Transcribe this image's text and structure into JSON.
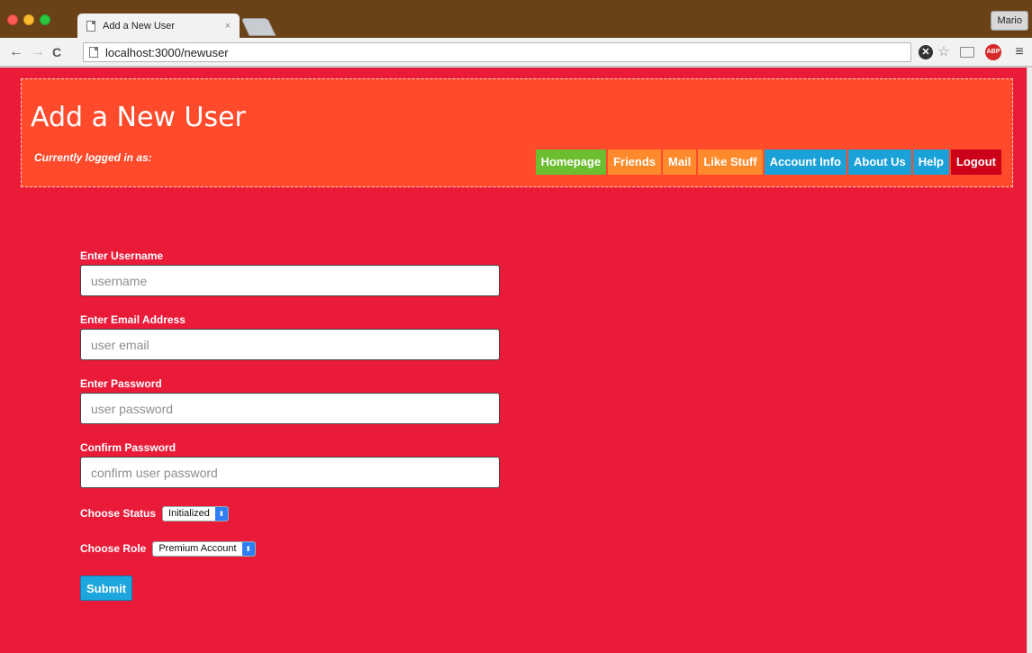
{
  "browser": {
    "tab_title": "Add a New User",
    "tab_close": "×",
    "user_profile": "Mario",
    "url": "localhost:3000/newuser",
    "nav": {
      "back": "←",
      "forward": "→",
      "reload": "C"
    },
    "toolbar_icons": [
      "block-icon",
      "star-icon",
      "cast-icon",
      "adblock-icon",
      "menu-icon"
    ]
  },
  "header": {
    "title": "Add a New User",
    "logged_in_label": "Currently logged in as:",
    "nav_items": [
      {
        "label": "Homepage",
        "color": "#6cbd2f"
      },
      {
        "label": "Friends",
        "color": "#ff8a2b"
      },
      {
        "label": "Mail",
        "color": "#ff8a2b"
      },
      {
        "label": "Like Stuff",
        "color": "#ff8a2b"
      },
      {
        "label": "Account Info",
        "color": "#1aa1d8"
      },
      {
        "label": "About Us",
        "color": "#1aa1d8"
      },
      {
        "label": "Help",
        "color": "#1aa1d8"
      },
      {
        "label": "Logout",
        "color": "#cc0018"
      }
    ]
  },
  "form": {
    "username": {
      "label": "Enter Username",
      "placeholder": "username",
      "value": ""
    },
    "email": {
      "label": "Enter Email Address",
      "placeholder": "user email",
      "value": ""
    },
    "password": {
      "label": "Enter Password",
      "placeholder": "user password",
      "value": ""
    },
    "confirm_password": {
      "label": "Confirm Password",
      "placeholder": "confirm user password",
      "value": ""
    },
    "status": {
      "label": "Choose Status",
      "selected": "Initialized"
    },
    "role": {
      "label": "Choose Role",
      "selected": "Premium Account"
    },
    "submit_label": "Submit"
  },
  "colors": {
    "page_background": "#ea1b39",
    "header_background": "#ff4a2b",
    "submit_button": "#1da5dd"
  }
}
